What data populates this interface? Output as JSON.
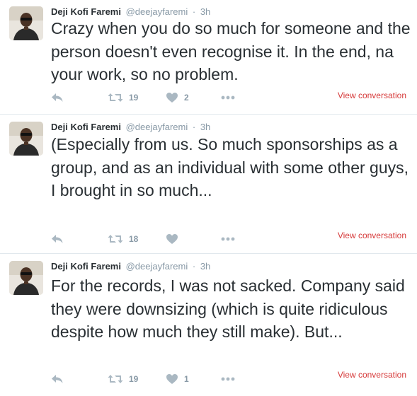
{
  "tweets": [
    {
      "name": "Deji Kofi Faremi",
      "handle": "@deejayfaremi",
      "separator": "·",
      "time": "3h",
      "text": "Crazy when you do so much for someone and the person doesn't even recognise it. In the end, na your work, so no problem.",
      "retweets": "19",
      "likes": "2",
      "view_label": "View conversation"
    },
    {
      "name": "Deji Kofi Faremi",
      "handle": "@deejayfaremi",
      "separator": "·",
      "time": "3h",
      "text": "(Especially from us. So much sponsorships as a group, and as an individual with some other guys, I brought in so much...",
      "retweets": "18",
      "likes": "",
      "view_label": "View conversation"
    },
    {
      "name": "Deji Kofi Faremi",
      "handle": "@deejayfaremi",
      "separator": "·",
      "time": "3h",
      "text": "For the records, I was not sacked. Company said they were downsizing (which is quite ridiculous despite how much they still make). But...",
      "retweets": "19",
      "likes": "1",
      "view_label": "View conversation"
    }
  ],
  "icons": {
    "reply": "reply-icon",
    "retweet": "retweet-icon",
    "like": "heart-icon",
    "more": "more-icon"
  },
  "colors": {
    "text": "#292f33",
    "muted": "#8899a6",
    "action_icon": "#aab8c2",
    "view_conversation": "#d63a3a",
    "divider": "#e1e8ed"
  }
}
